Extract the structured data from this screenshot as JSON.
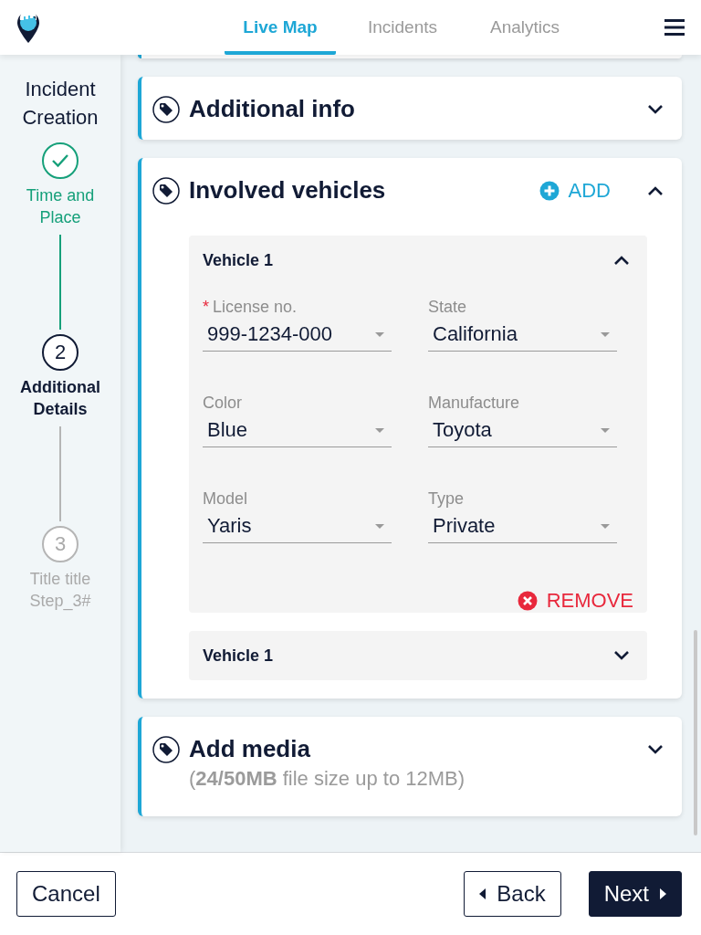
{
  "nav": {
    "tabs": [
      {
        "label": "Live Map",
        "selected": true
      },
      {
        "label": "Incidents",
        "selected": false
      },
      {
        "label": "Analytics",
        "selected": false
      }
    ]
  },
  "sidebar": {
    "title": "Incident Creation",
    "steps": [
      {
        "label": "Time and Place",
        "completed": true,
        "selected": false
      },
      {
        "marker": "2",
        "label": "Additional Details",
        "completed": false,
        "selected": true
      },
      {
        "marker": "3",
        "label": "Title title Step_3#",
        "completed": false,
        "selected": false
      }
    ]
  },
  "sections": [
    {
      "title": "Additional info",
      "expanded": false
    },
    {
      "title": "Involved vehicles",
      "expanded": true,
      "action": "ADD",
      "vehicles": [
        {
          "title": "Vehicle 1",
          "expanded": true,
          "fields": [
            {
              "label": "License no.",
              "value": "999-1234-000",
              "required_mark": "*"
            },
            {
              "label": "State",
              "value": "California"
            },
            {
              "label": "Color",
              "value": "Blue"
            },
            {
              "label": "Manufacture",
              "value": "Toyota"
            },
            {
              "label": "Model",
              "value": "Yaris"
            },
            {
              "label": "Type",
              "value": "Private"
            }
          ],
          "remove": "REMOVE"
        },
        {
          "title": "Vehicle 1",
          "expanded": false
        }
      ]
    },
    {
      "title": "Add media",
      "expanded": false,
      "subtitle": "(**24/50MB** file size up to 12MB)"
    }
  ],
  "footer": {
    "cancel": "Cancel",
    "back": "Back",
    "next": "Next"
  }
}
